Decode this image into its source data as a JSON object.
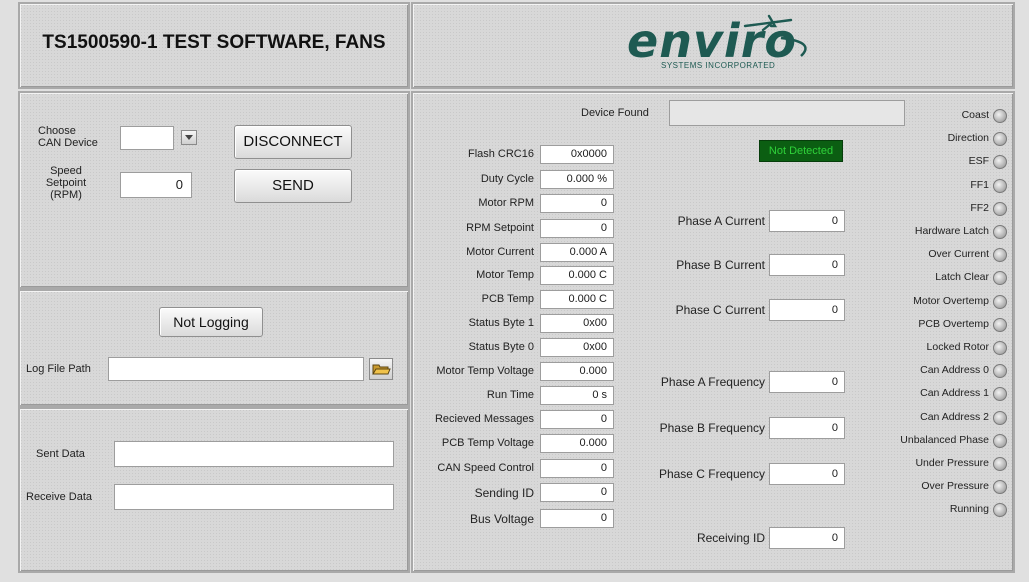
{
  "header": {
    "title": "TS1500590-1 TEST SOFTWARE, FANS",
    "logo_text": "enviro",
    "logo_subtext": "SYSTEMS INCORPORATED"
  },
  "connection": {
    "can_device_label": "Choose CAN Device",
    "can_device_value": "",
    "disconnect_label": "DISCONNECT",
    "speed_label": "Speed Setpoint (RPM)",
    "speed_value": "0",
    "send_label": "SEND"
  },
  "logging": {
    "status_label": "Not Logging",
    "log_file_path_label": "Log File Path",
    "log_file_path_value": ""
  },
  "data_io": {
    "sent_label": "Sent Data",
    "sent_value": "",
    "receive_label": "Receive Data",
    "receive_value": ""
  },
  "device": {
    "found_label": "Device Found",
    "found_value": "",
    "detect_status": "Not Detected"
  },
  "readings": [
    {
      "label": "Flash CRC16",
      "value": "0x0000"
    },
    {
      "label": "Duty Cycle",
      "value": "0.000 %"
    },
    {
      "label": "Motor RPM",
      "value": "0"
    },
    {
      "label": "RPM Setpoint",
      "value": "0"
    },
    {
      "label": "Motor Current",
      "value": "0.000 A"
    },
    {
      "label": "Motor Temp",
      "value": "0.000 C"
    },
    {
      "label": "PCB Temp",
      "value": "0.000 C"
    },
    {
      "label": "Status Byte 1",
      "value": "0x00"
    },
    {
      "label": "Status Byte 0",
      "value": "0x00"
    },
    {
      "label": "Motor Temp Voltage",
      "value": "0.000"
    },
    {
      "label": "Run Time",
      "value": "0 s"
    },
    {
      "label": "Recieved Messages",
      "value": "0"
    },
    {
      "label": "PCB Temp Voltage",
      "value": "0.000"
    },
    {
      "label": "CAN Speed Control",
      "value": "0"
    },
    {
      "label": "Sending ID",
      "value": "0"
    },
    {
      "label": "Bus Voltage",
      "value": "0"
    }
  ],
  "phases": [
    {
      "label": "Phase A Current",
      "value": "0"
    },
    {
      "label": "Phase B Current",
      "value": "0"
    },
    {
      "label": "Phase C Current",
      "value": "0"
    },
    {
      "label": "Phase A Frequency",
      "value": "0"
    },
    {
      "label": "Phase B Frequency",
      "value": "0"
    },
    {
      "label": "Phase C Frequency",
      "value": "0"
    },
    {
      "label": "Receiving ID",
      "value": "0"
    }
  ],
  "indicators": [
    "Coast",
    "Direction",
    "ESF",
    "FF1",
    "FF2",
    "Hardware Latch",
    "Over Current",
    "Latch Clear",
    "Motor Overtemp",
    "PCB Overtemp",
    "Locked Rotor",
    "Can Address 0",
    "Can Address 1",
    "Can Address 2",
    "Unbalanced Phase",
    "Under Pressure",
    "Over Pressure",
    "Running"
  ],
  "colors": {
    "not_detected_bg": "#0b5e12",
    "not_detected_text": "#2fd23a",
    "logo": "#1e5a52"
  }
}
